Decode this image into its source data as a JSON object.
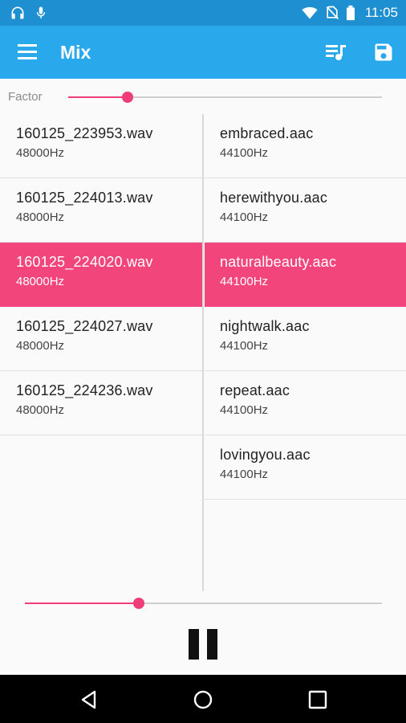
{
  "status_bar": {
    "time": "11:05",
    "icons": [
      "headphones-icon",
      "microphone-icon",
      "wifi-icon",
      "no-sim-icon",
      "battery-icon"
    ]
  },
  "app_bar": {
    "title": "Mix",
    "background_color": "#29a8ec",
    "icons": [
      "menu-icon",
      "queue-music-icon",
      "save-icon"
    ]
  },
  "factor": {
    "label": "Factor",
    "value": 0.19
  },
  "left_list": [
    {
      "name": "160125_223953.wav",
      "rate": "48000Hz",
      "selected": false
    },
    {
      "name": "160125_224013.wav",
      "rate": "48000Hz",
      "selected": false
    },
    {
      "name": "160125_224020.wav",
      "rate": "48000Hz",
      "selected": true
    },
    {
      "name": "160125_224027.wav",
      "rate": "48000Hz",
      "selected": false
    },
    {
      "name": "160125_224236.wav",
      "rate": "48000Hz",
      "selected": false
    }
  ],
  "right_list": [
    {
      "name": "embraced.aac",
      "rate": "44100Hz",
      "selected": false
    },
    {
      "name": "herewithyou.aac",
      "rate": "44100Hz",
      "selected": false
    },
    {
      "name": "naturalbeauty.aac",
      "rate": "44100Hz",
      "selected": true
    },
    {
      "name": "nightwalk.aac",
      "rate": "44100Hz",
      "selected": false
    },
    {
      "name": "repeat.aac",
      "rate": "44100Hz",
      "selected": false
    },
    {
      "name": "lovingyou.aac",
      "rate": "44100Hz",
      "selected": false
    }
  ],
  "playback": {
    "progress": 0.32,
    "state_icon": "pause-icon"
  },
  "colors": {
    "accent": "#ef3d7a",
    "selected_row": "#f2457c",
    "status_bar": "#1e8fd0"
  },
  "nav_bar": {
    "icons": [
      "back-icon",
      "home-icon",
      "recents-icon"
    ]
  }
}
